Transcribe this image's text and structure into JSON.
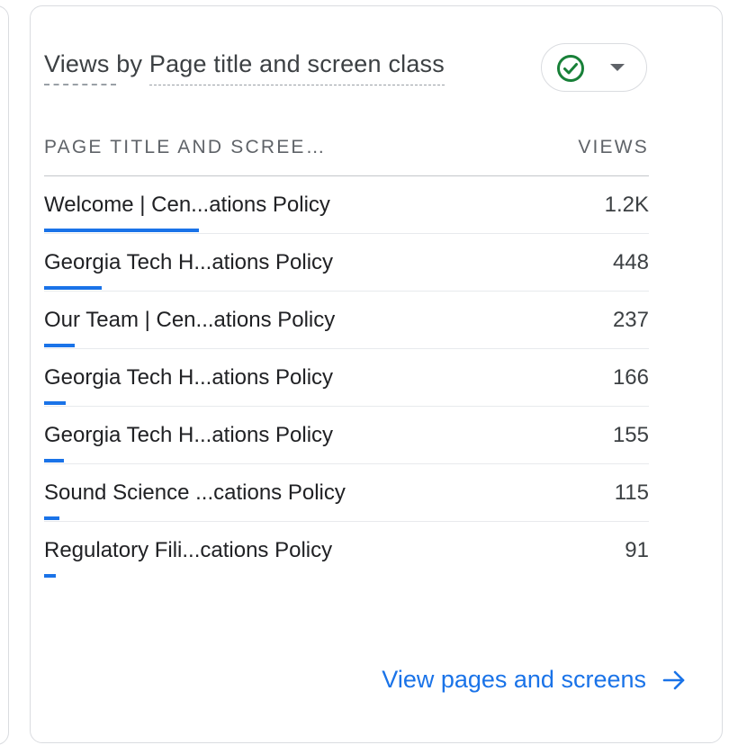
{
  "card": {
    "title_prefix": "Views",
    "title_by": " by ",
    "title_dimension": "Page title and screen class",
    "compare_icon": "check-circle-icon",
    "dropdown_icon": "caret-down-icon",
    "accent_color": "#1a73e8",
    "check_color": "#188038"
  },
  "table": {
    "headers": {
      "dimension": "PAGE TITLE AND SCREE…",
      "metric": "VIEWS"
    },
    "rows": [
      {
        "name": "Welcome | Cen...ations Policy",
        "value": "1.2K",
        "share": 1.0
      },
      {
        "name": "Georgia Tech H...ations Policy",
        "value": "448",
        "share": 0.373
      },
      {
        "name": "Our Team | Cen...ations Policy",
        "value": "237",
        "share": 0.198
      },
      {
        "name": "Georgia Tech H...ations Policy",
        "value": "166",
        "share": 0.138
      },
      {
        "name": "Georgia Tech H...ations Policy",
        "value": "155",
        "share": 0.129
      },
      {
        "name": "Sound Science ...cations Policy",
        "value": "115",
        "share": 0.096
      },
      {
        "name": "Regulatory Fili...cations Policy",
        "value": "91",
        "share": 0.076
      }
    ]
  },
  "footer": {
    "link_label": "View pages and screens",
    "link_icon": "arrow-right-icon"
  }
}
